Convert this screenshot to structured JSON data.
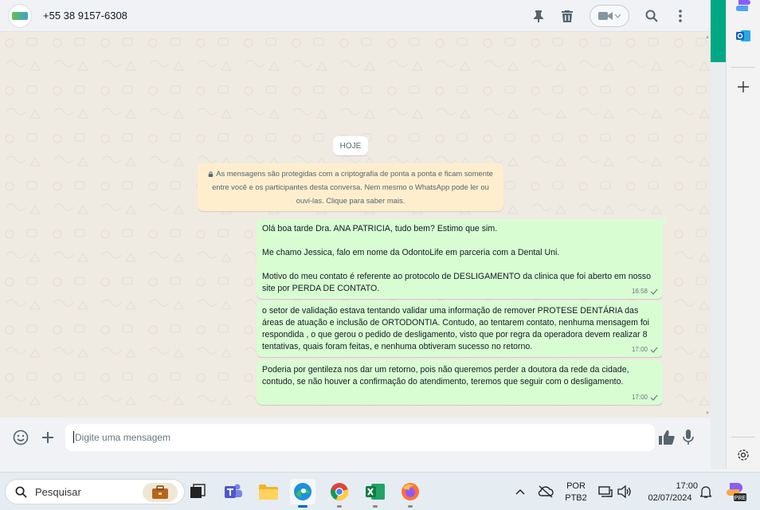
{
  "header": {
    "contact_name": "+55 38 9157-6308",
    "icons": [
      "pin-icon",
      "trash-icon",
      "video-call-icon",
      "search-icon",
      "more-icon"
    ]
  },
  "chat": {
    "date_label": "HOJE",
    "encryption_notice": "As mensagens são protegidas com a criptografia de ponta a ponta e ficam somente entre você e os participantes desta conversa. Nem mesmo o WhatsApp pode ler ou ouvi-las. Clique para saber mais.",
    "messages": [
      {
        "text": "Olá boa tarde Dra. ANA PATRICIA, tudo bem? Estimo que sim.\n\nMe chamo Jessica, falo em nome da OdontoLife em parceria com a Dental Uni.\n\nMotivo do meu contato é referente ao protocolo de DESLIGAMENTO da clinica que foi aberto em nosso site por PERDA DE CONTATO.",
        "time": "16:58"
      },
      {
        "text": "o setor de validação estava tentando validar uma informação de remover PROTESE DENTÁRIA das áreas de atuação e inclusão de ORTODONTIA. Contudo, ao tentarem contato, nenhuma mensagem foi respondida , o que gerou o pedido de desligamento, visto que por regra da operadora devem realizar 8 tentativas, quais foram feitas, e nenhuma obtiveram sucesso no retorno.",
        "time": "17:00"
      },
      {
        "text": "Poderia por gentileza nos dar um retorno, pois não queremos perder a doutora da rede da cidade, contudo, se não houver a confirmação do atendimento, teremos que seguir com o desligamento.",
        "time": "17:00"
      }
    ]
  },
  "composer": {
    "placeholder": "Digite uma mensagem",
    "value": ""
  },
  "taskbar": {
    "search_label": "Pesquisar",
    "language": "POR",
    "keyboard": "PTB2",
    "time": "17:00",
    "date": "02/07/2024",
    "copilot_badge": "PRE"
  },
  "colors": {
    "accent": "#00a884",
    "outgoing_bubble": "#d9fdd3",
    "notice_bg": "#ffeecd",
    "chat_bg": "#efeae2"
  }
}
